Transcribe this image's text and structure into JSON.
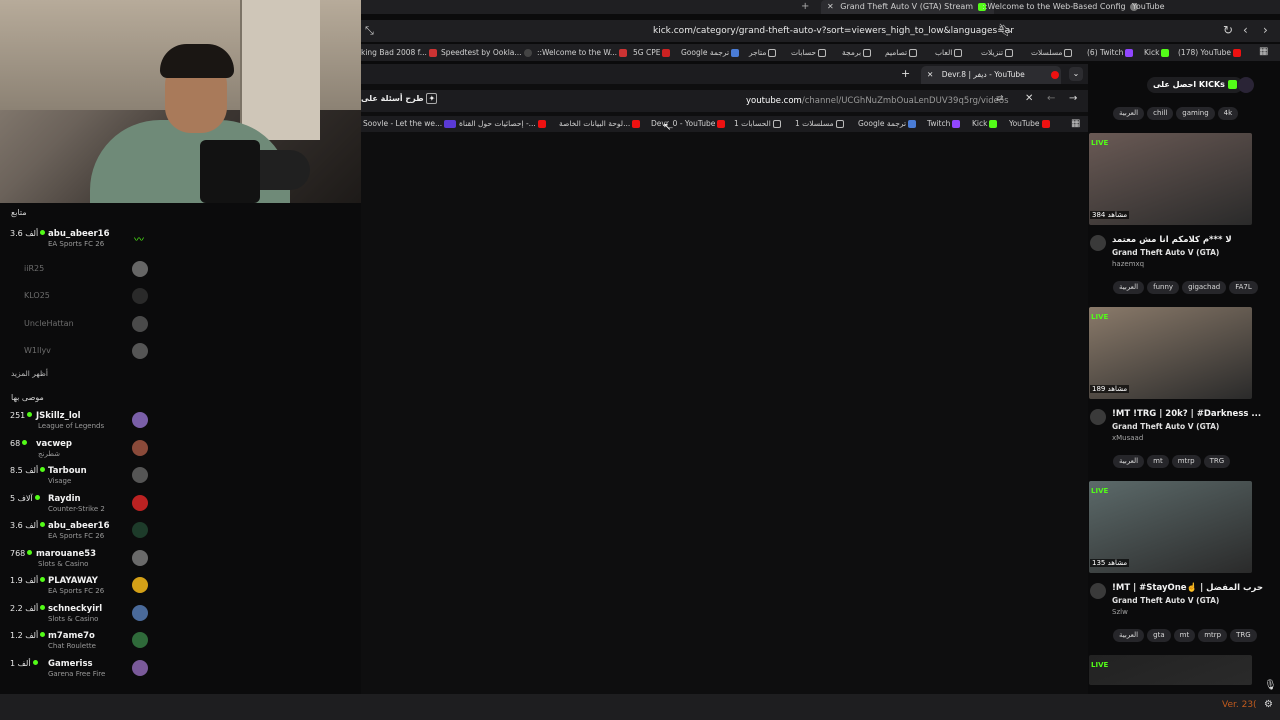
{
  "browser": {
    "tabs": [
      "Grand Theft Auto V (GTA) Stream",
      "::Welcome to the Web-Based Config",
      "YouTube"
    ],
    "url": "kick.com/category/grand-theft-auto-v?sort=viewers_high_to_low&languages=ar",
    "bookmarks": [
      "king Bad 2008 f...",
      "Speedtest by Ookla...",
      "::Welcome to the W...",
      "5G CPE",
      "Google ترجمة",
      "متاجر",
      "حسابات",
      "برمجة",
      "تصاميم",
      "العاب",
      "تنزيلات",
      "مسلسلات",
      "(6) Twitch",
      "Kick",
      "(178) YouTube"
    ]
  },
  "youtube_window": {
    "tab_label": "Devr.8 | ديفر - YouTube",
    "url": "youtube.com/channel/UCGhNuZmbOuaLenDUV39q5rg/videos",
    "ask_button": "طرح أسئلة على",
    "bookmarks": [
      "Soovle - Let the we...",
      "إحصائيات حول القناة -...",
      "لوحة البيانات الخاصة...",
      "Devr_0 - YouTube",
      "الحسابات 1",
      "مسلسلات 1",
      "Google ترجمة",
      "Twitch",
      "Kick",
      "YouTube"
    ]
  },
  "sidebar": {
    "followed_title": "متابع",
    "followed": [
      {
        "viewers": "3.6 ألف",
        "name": "abu_abeer16",
        "category": "EA Sports FC 26",
        "color": "#1d3b2a"
      }
    ],
    "offline": [
      "iiR25",
      "KLO25",
      "UncleHattan",
      "W1llyv"
    ],
    "show_more": "أظهر المزيد",
    "recommended_title": "موصى بها",
    "recommended": [
      {
        "viewers": "251",
        "name": "JSkillz_lol",
        "category": "League of Legends",
        "color": "#7a5fa8"
      },
      {
        "viewers": "68",
        "name": "vacwep",
        "category": "شطرنج",
        "color": "#8a4a3a"
      },
      {
        "viewers": "8.5 ألف",
        "name": "Tarboun",
        "category": "Visage",
        "color": "#555"
      },
      {
        "viewers": "5 آلاف",
        "name": "Raydin",
        "category": "Counter-Strike 2",
        "color": "#b22"
      },
      {
        "viewers": "3.6 ألف",
        "name": "abu_abeer16",
        "category": "EA Sports FC 26",
        "color": "#1d3b2a"
      },
      {
        "viewers": "768",
        "name": "marouane53",
        "category": "Slots & Casino",
        "color": "#6a6a6a"
      },
      {
        "viewers": "1.9 ألف",
        "name": "PLAYAWAY",
        "category": "EA Sports FC 26",
        "color": "#d4a017"
      },
      {
        "viewers": "2.2 ألف",
        "name": "schneckyirl",
        "category": "Slots & Casino",
        "color": "#4a6a9a"
      },
      {
        "viewers": "1.2 ألف",
        "name": "m7ame7o",
        "category": "Chat Roulette",
        "color": "#2f6a3a"
      },
      {
        "viewers": "1 ألف",
        "name": "Gameriss",
        "category": "Garena Free Fire",
        "color": "#7a5a9a"
      }
    ]
  },
  "right": {
    "kicks_button": "احصل على KICKs",
    "top_tags": [
      "العربية",
      "chill",
      "gaming",
      "4k"
    ],
    "cards": [
      {
        "live": "LIVE",
        "views": "384 مشاهد",
        "title": "لا ***م كلامكم انا مش معتمد",
        "game": "Grand Theft Auto V (GTA)",
        "user": "hazemxq",
        "tags": [
          "العربية",
          "funny",
          "gigachad",
          "FA7L"
        ],
        "thumb": "#6a5a55"
      },
      {
        "live": "LIVE",
        "views": "189 مشاهد",
        "title": "!MT !TRG | 20k? | #Darkness ...",
        "game": "Grand Theft Auto V (GTA)",
        "user": "xMusaad",
        "tags": [
          "العربية",
          "mt",
          "mtrp",
          "TRG"
        ],
        "thumb": "#8a7a6a"
      },
      {
        "live": "LIVE",
        "views": "135 مشاهد",
        "title": "!MT | #StayOne☝️ | حرب المفضل",
        "game": "Grand Theft Auto V (GTA)",
        "user": "Szlw",
        "tags": [
          "العربية",
          "gta",
          "mt",
          "mtrp",
          "TRG"
        ],
        "thumb": "#5c6a6a"
      },
      {
        "live": "LIVE",
        "views": "",
        "title": "",
        "game": "",
        "user": "",
        "tags": [],
        "thumb": "#222"
      }
    ]
  },
  "footer": {
    "version": "Ver. 23("
  }
}
